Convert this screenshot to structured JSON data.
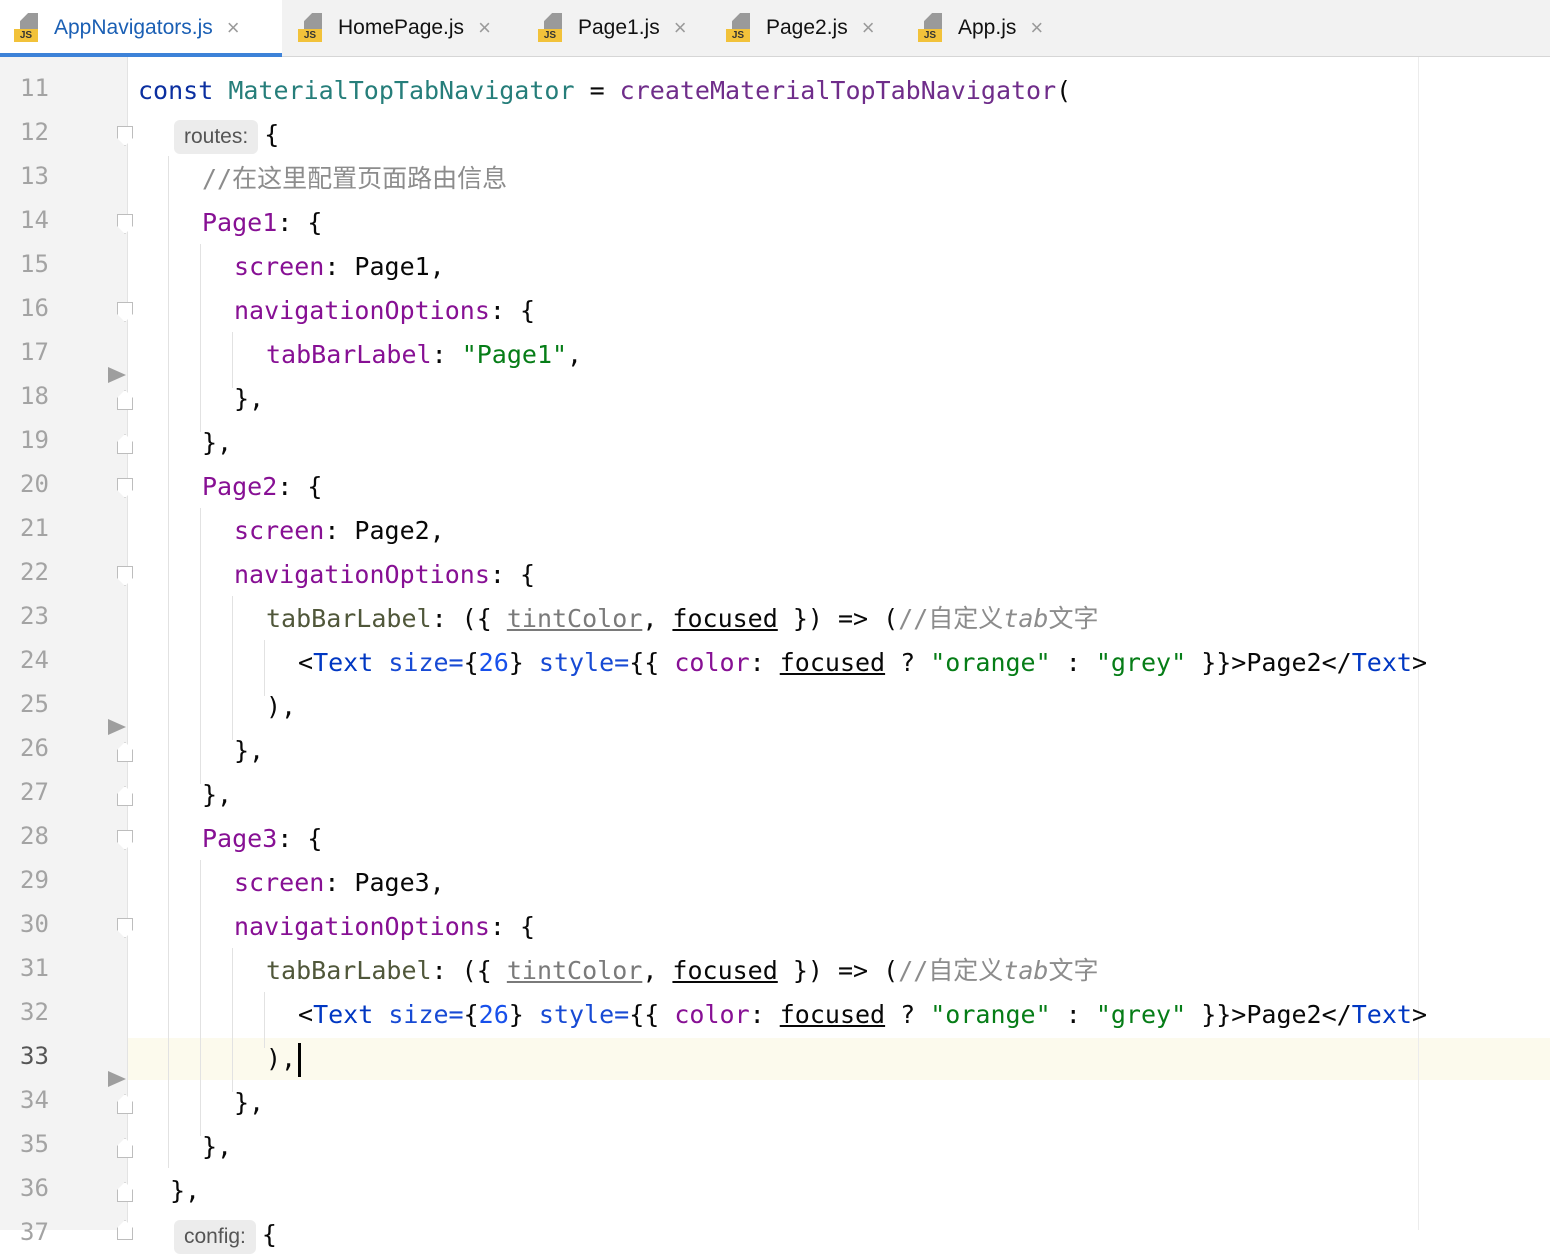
{
  "tabs": [
    {
      "name": "AppNavigators.js",
      "active": true
    },
    {
      "name": "HomePage.js",
      "active": false
    },
    {
      "name": "Page1.js",
      "active": false
    },
    {
      "name": "Page2.js",
      "active": false
    },
    {
      "name": "App.js",
      "active": false
    }
  ],
  "tab_badge": "JS",
  "tab_close": "×",
  "editor": {
    "lines": [
      "11",
      "12",
      "13",
      "14",
      "15",
      "16",
      "17",
      "18",
      "19",
      "20",
      "21",
      "22",
      "23",
      "24",
      "25",
      "26",
      "27",
      "28",
      "29",
      "30",
      "31",
      "32",
      "33",
      "34",
      "35",
      "36",
      "37"
    ],
    "current_line": "33",
    "code": {
      "l11": {
        "kw": "const",
        "def": "MaterialTopTabNavigator",
        "op": " = ",
        "fn": "createMaterialTopTabNavigator",
        "tail": "("
      },
      "l12": {
        "hint": "routes:",
        "tail": "{"
      },
      "l13": {
        "comment": "//在这里配置页面路由信息"
      },
      "l14": {
        "prop": "Page1",
        "tail": ": {"
      },
      "l15": {
        "prop": "screen",
        "tail": ": Page1,"
      },
      "l16": {
        "prop": "navigationOptions",
        "tail": ": {"
      },
      "l17": {
        "prop": "tabBarLabel",
        "sep": ": ",
        "str": "\"Page1\"",
        "tail": ","
      },
      "l18": {
        "text": "},"
      },
      "l19": {
        "text": "},"
      },
      "l20": {
        "prop": "Page2",
        "tail": ": {"
      },
      "l21": {
        "prop": "screen",
        "tail": ": Page2,"
      },
      "l22": {
        "prop": "navigationOptions",
        "tail": ": {"
      },
      "l23": {
        "prop": "tabBarLabel",
        "p1": ": ({ ",
        "u1": "tintColor",
        "p2": ", ",
        "u2": "focused",
        "p3": " }) => (",
        "cmt": "//自定义",
        "cmti": "tab",
        "cmt2": "文字"
      },
      "l24": {
        "lt": "<",
        "tag": "Text",
        "sp": " ",
        "attr1": "size=",
        "b1": "{",
        "num": "26",
        "b2": "} ",
        "attr2": "style=",
        "b3": "{{ ",
        "prop": "color",
        "c1": ": ",
        "u": "focused",
        "q": " ? ",
        "s1": "\"orange\"",
        "colon": " : ",
        "s2": "\"grey\"",
        "b4": " }}>Page2</",
        "tag2": "Text",
        "gt": ">"
      },
      "l25": {
        "text": "),"
      },
      "l26": {
        "text": "},"
      },
      "l27": {
        "text": "},"
      },
      "l28": {
        "prop": "Page3",
        "tail": ": {"
      },
      "l29": {
        "prop": "screen",
        "tail": ": Page3,"
      },
      "l30": {
        "prop": "navigationOptions",
        "tail": ": {"
      },
      "l31": {
        "prop": "tabBarLabel",
        "p1": ": ({ ",
        "u1": "tintColor",
        "p2": ", ",
        "u2": "focused",
        "p3": " }) => (",
        "cmt": "//自定义",
        "cmti": "tab",
        "cmt2": "文字"
      },
      "l32": {
        "lt": "<",
        "tag": "Text",
        "sp": " ",
        "attr1": "size=",
        "b1": "{",
        "num": "26",
        "b2": "} ",
        "attr2": "style=",
        "b3": "{{ ",
        "prop": "color",
        "c1": ": ",
        "u": "focused",
        "q": " ? ",
        "s1": "\"orange\"",
        "colon": " : ",
        "s2": "\"grey\"",
        "b4": " }}>Page2</",
        "tag2": "Text",
        "gt": ">"
      },
      "l33": {
        "text": "),"
      },
      "l34": {
        "text": "},"
      },
      "l35": {
        "text": "},"
      },
      "l36": {
        "text": "},"
      },
      "l37": {
        "hint": "config:",
        "tail": "{"
      }
    }
  }
}
